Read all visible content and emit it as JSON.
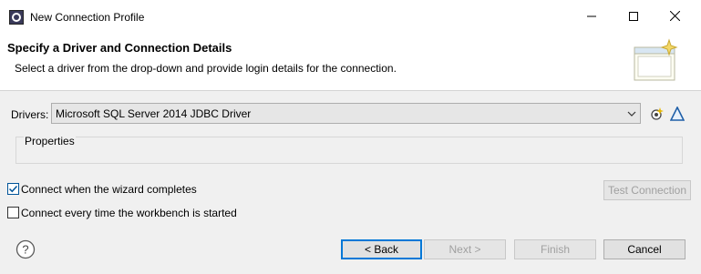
{
  "window": {
    "title": "New Connection Profile"
  },
  "header": {
    "title": "Specify a Driver and Connection Details",
    "description": "Select a driver from the drop-down and provide login details for the connection."
  },
  "drivers": {
    "label": "Drivers:",
    "selected": "Microsoft SQL Server 2014 JDBC Driver"
  },
  "properties": {
    "label": "Properties"
  },
  "options": {
    "connect_when_complete": {
      "label": "Connect when the wizard completes",
      "checked": true
    },
    "connect_every_time": {
      "label": "Connect every time the workbench is started",
      "checked": false
    }
  },
  "buttons": {
    "test_connection": "Test Connection",
    "back": "< Back",
    "next": "Next >",
    "finish": "Finish",
    "cancel": "Cancel"
  },
  "icons": {
    "app": "eclipse-app-icon",
    "minimize": "minimize-icon",
    "maximize": "maximize-icon",
    "close": "close-icon",
    "new_driver": "new-driver-icon",
    "edit_driver": "edit-driver-icon",
    "help": "help-icon",
    "banner": "wizard-banner-icon"
  },
  "colors": {
    "accent": "#0078d7",
    "checkbox": "#005499"
  }
}
